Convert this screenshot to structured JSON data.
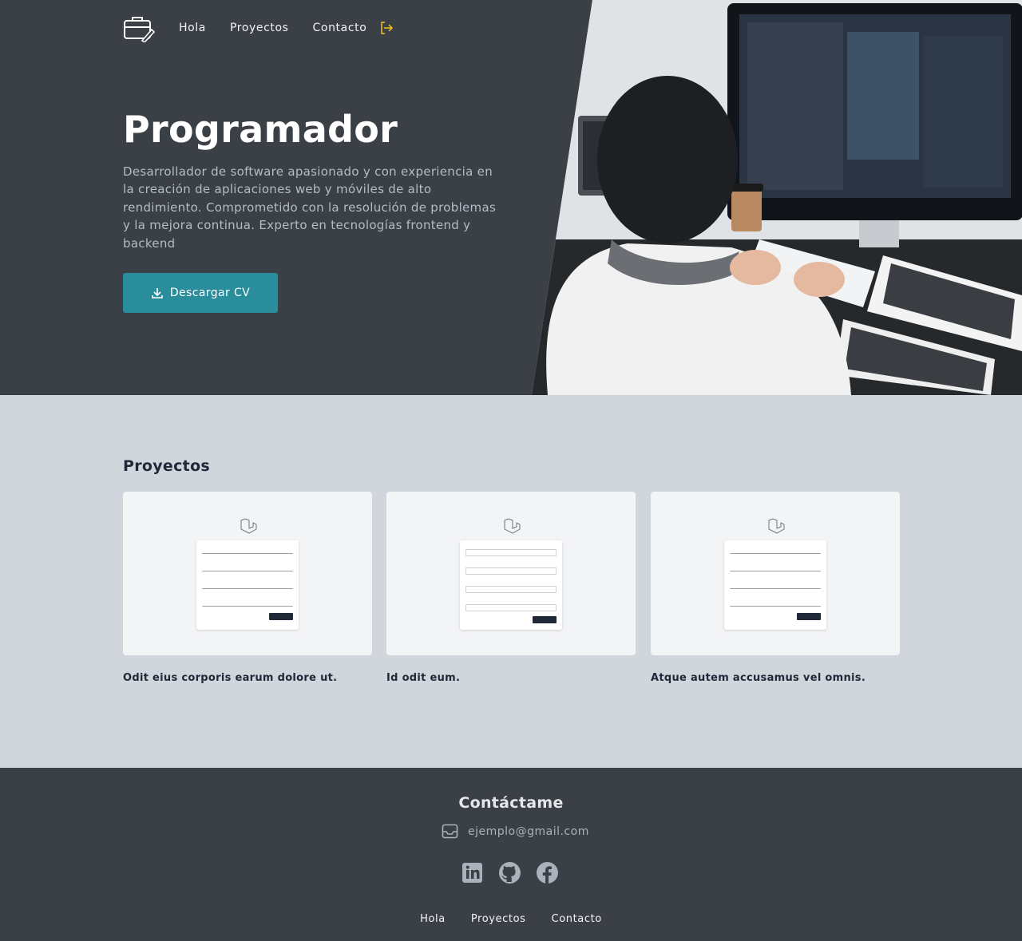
{
  "nav": {
    "items": [
      {
        "label": "Hola"
      },
      {
        "label": "Proyectos"
      },
      {
        "label": "Contacto"
      }
    ]
  },
  "hero": {
    "title": "Programador",
    "description": "Desarrollador de software apasionado y con experiencia en la creación de aplicaciones web y móviles de alto rendimiento. Comprometido con la resolución de problemas y la mejora continua. Experto en tecnologías frontend y backend",
    "cv_button": "Descargar CV"
  },
  "projects": {
    "heading": "Proyectos",
    "items": [
      {
        "title": "Odit eius corporis earum dolore ut."
      },
      {
        "title": "Id odit eum."
      },
      {
        "title": "Atque autem accusamus vel omnis."
      }
    ]
  },
  "footer": {
    "heading": "Contáctame",
    "email": "ejemplo@gmail.com",
    "social": [
      "linkedin-icon",
      "github-icon",
      "facebook-icon"
    ],
    "nav": [
      {
        "label": "Hola"
      },
      {
        "label": "Proyectos"
      },
      {
        "label": "Contacto"
      }
    ]
  },
  "colors": {
    "dark": "#3b3f46",
    "accent": "#2a8d9c",
    "logout": "#f5c518",
    "light_bg": "#d1d5dc"
  }
}
